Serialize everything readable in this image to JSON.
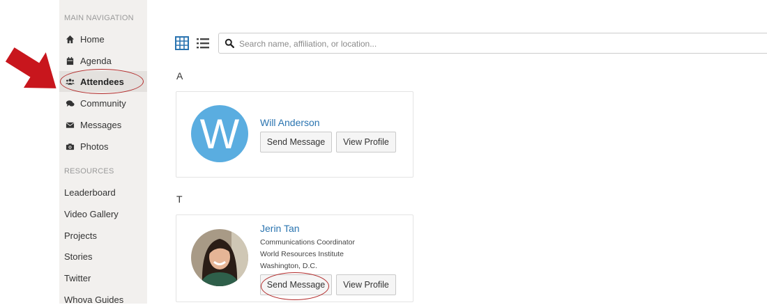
{
  "sidebar": {
    "main_nav_heading": "MAIN NAVIGATION",
    "main_nav": [
      {
        "label": "Home",
        "icon": "home-icon"
      },
      {
        "label": "Agenda",
        "icon": "calendar-icon"
      },
      {
        "label": "Attendees",
        "icon": "users-icon",
        "active": true
      },
      {
        "label": "Community",
        "icon": "comments-icon"
      },
      {
        "label": "Messages",
        "icon": "envelope-icon"
      },
      {
        "label": "Photos",
        "icon": "camera-icon"
      }
    ],
    "resources_heading": "RESOURCES",
    "resources": [
      "Leaderboard",
      "Video Gallery",
      "Projects",
      "Stories",
      "Twitter",
      "Whova Guides"
    ]
  },
  "toolbar": {
    "grid_view_icon": "grid-view-icon",
    "list_view_icon": "list-view-icon",
    "search_placeholder": "Search name, affiliation, or location..."
  },
  "groups": [
    {
      "letter": "A",
      "attendees": [
        {
          "name": "Will Anderson",
          "avatar_letter": "W",
          "avatar_color": "#5aade0",
          "send_label": "Send Message",
          "view_label": "View Profile"
        }
      ]
    },
    {
      "letter": "T",
      "attendees": [
        {
          "name": "Jerin Tan",
          "title": "Communications Coordinator",
          "affiliation": "World Resources Institute",
          "location": "Washington, D.C.",
          "send_label": "Send Message",
          "view_label": "View Profile"
        }
      ]
    }
  ],
  "colors": {
    "accent": "#2a74b0",
    "annotation_red": "#b22a2a",
    "sidebar_bg": "#f2f0ee"
  }
}
